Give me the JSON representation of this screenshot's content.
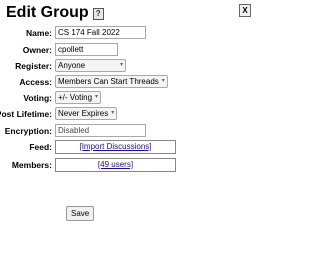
{
  "header": {
    "title": "Edit Group",
    "help_icon": "?",
    "close_icon": "X"
  },
  "form": {
    "name": {
      "label": "Name:",
      "value": "CS 174 Fall 2022"
    },
    "owner": {
      "label": "Owner:",
      "value": "cpollett"
    },
    "register": {
      "label": "Register:",
      "selected": "Anyone"
    },
    "access": {
      "label": "Access:",
      "selected": "Members Can Start Threads"
    },
    "voting": {
      "label": "Voting:",
      "selected": "+/- Voting"
    },
    "post_lifetime": {
      "label": "Post Lifetime:",
      "selected": "Never Expires"
    },
    "encryption": {
      "label": "Encryption:",
      "value": "Disabled"
    },
    "feed": {
      "label": "Feed:",
      "link": "[Import Discussions]"
    },
    "members": {
      "label": "Members:",
      "link": "[49 users]"
    },
    "save_label": "Save"
  },
  "icons": {
    "dropdown": "chevron-down-icon",
    "link_color": "#1a0dab"
  }
}
